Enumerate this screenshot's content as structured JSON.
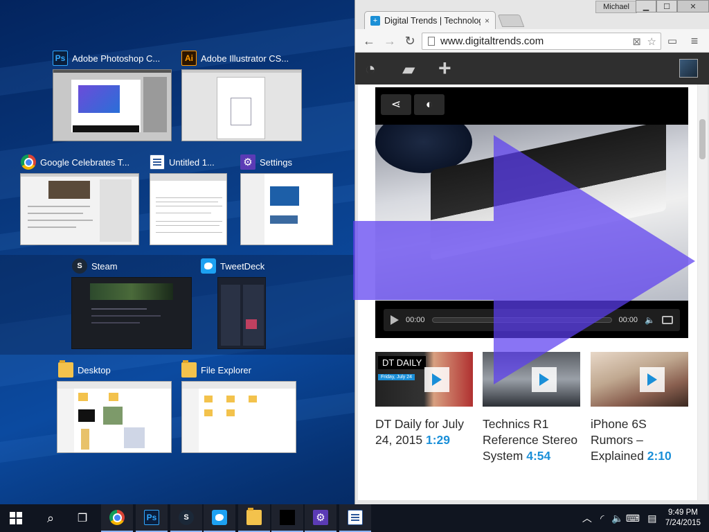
{
  "snap_assist": {
    "row1": [
      {
        "title": "Adobe Photoshop C...",
        "icon": "photoshop-icon",
        "icon_text": "Ps"
      },
      {
        "title": "Adobe Illustrator CS...",
        "icon": "illustrator-icon",
        "icon_text": "Ai"
      }
    ],
    "row2": [
      {
        "title": "Google Celebrates T...",
        "icon": "chrome-icon"
      },
      {
        "title": "Untitled 1...",
        "icon": "document-icon"
      },
      {
        "title": "Settings",
        "icon": "settings-icon",
        "icon_text": "⚙"
      }
    ],
    "row3": [
      {
        "title": "Steam",
        "icon": "steam-icon",
        "icon_text": "S"
      },
      {
        "title": "TweetDeck",
        "icon": "twitter-icon"
      }
    ],
    "row4": [
      {
        "title": "Desktop",
        "icon": "folder-icon"
      },
      {
        "title": "File Explorer",
        "icon": "folder-icon"
      }
    ]
  },
  "chrome": {
    "user": "Michael",
    "tab_title": "Digital Trends | Technolog",
    "url": "www.digitaltrends.com",
    "tab_close": "×"
  },
  "video": {
    "time_current": "00:00",
    "time_total": "00:00",
    "progress": 0.0
  },
  "cards": [
    {
      "title": "DT Daily for July 24, 2015",
      "duration": "1:29",
      "badge": "DT DAILY",
      "subbadge": "Friday, July 24"
    },
    {
      "title": "Technics R1 Reference Stereo System",
      "duration": "4:54"
    },
    {
      "title": "iPhone 6S Rumors – Explained",
      "duration": "2:10"
    }
  ],
  "taskbar": {
    "time": "9:49 PM",
    "date": "7/24/2015",
    "apps": [
      "start",
      "search",
      "task-view",
      "chrome",
      "photoshop",
      "steam",
      "twitter",
      "file-explorer",
      "blank",
      "settings",
      "document"
    ]
  },
  "colors": {
    "accent": "#1a8fd8",
    "snap_arrow": "#5b3ff0",
    "taskbar": "#101520"
  }
}
